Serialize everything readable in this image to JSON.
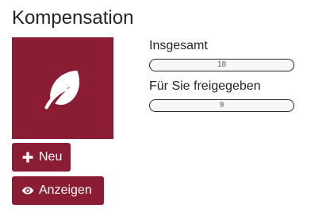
{
  "header": {
    "title": "Kompensation"
  },
  "tile": {
    "icon": "leaf-icon",
    "color": "#8a1c33"
  },
  "stats": {
    "total": {
      "label": "Insgesamt",
      "value": "18",
      "progress": 0
    },
    "released": {
      "label": "Für Sie freigegeben",
      "value": "9",
      "progress": 0
    }
  },
  "actions": {
    "new_label": "Neu",
    "new_icon": "plus-icon",
    "show_label": "Anzeigen",
    "show_icon": "eye-icon"
  },
  "colors": {
    "accent": "#8a1c33",
    "text": "#212529"
  }
}
